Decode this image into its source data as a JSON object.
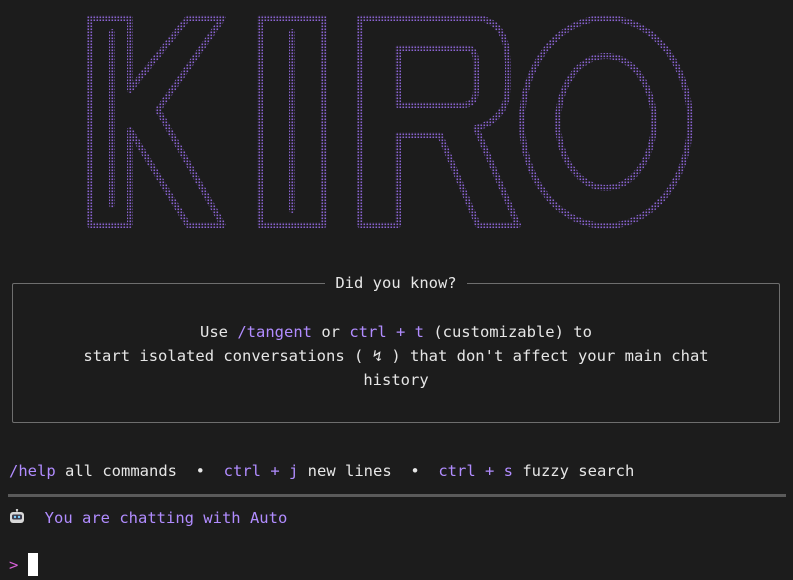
{
  "logo": {
    "name": "kiro-logo",
    "color": "#8a63d2"
  },
  "tip": {
    "title": "Did you know?",
    "line1": {
      "pre": "Use ",
      "cmd": "/tangent",
      "mid": " or ",
      "key": "ctrl + t",
      "post": " (customizable) to"
    },
    "line2": "start isolated conversations ( ↯ ) that don't affect your main chat",
    "line3": "history"
  },
  "hints": [
    {
      "key": "/help",
      "desc": " all commands"
    },
    {
      "sep": "  •  "
    },
    {
      "key": "ctrl + j",
      "desc": " new lines"
    },
    {
      "sep": "  •  "
    },
    {
      "key": "ctrl + s",
      "desc": " fuzzy search"
    }
  ],
  "chat": {
    "icon": "robot-icon",
    "text": "You are chatting with Auto"
  },
  "prompt": {
    "symbol": ">"
  },
  "colors": {
    "accent": "#b18cff",
    "prompt": "#d65fd6",
    "text": "#e6e6e6",
    "background": "#1c1c1c"
  }
}
